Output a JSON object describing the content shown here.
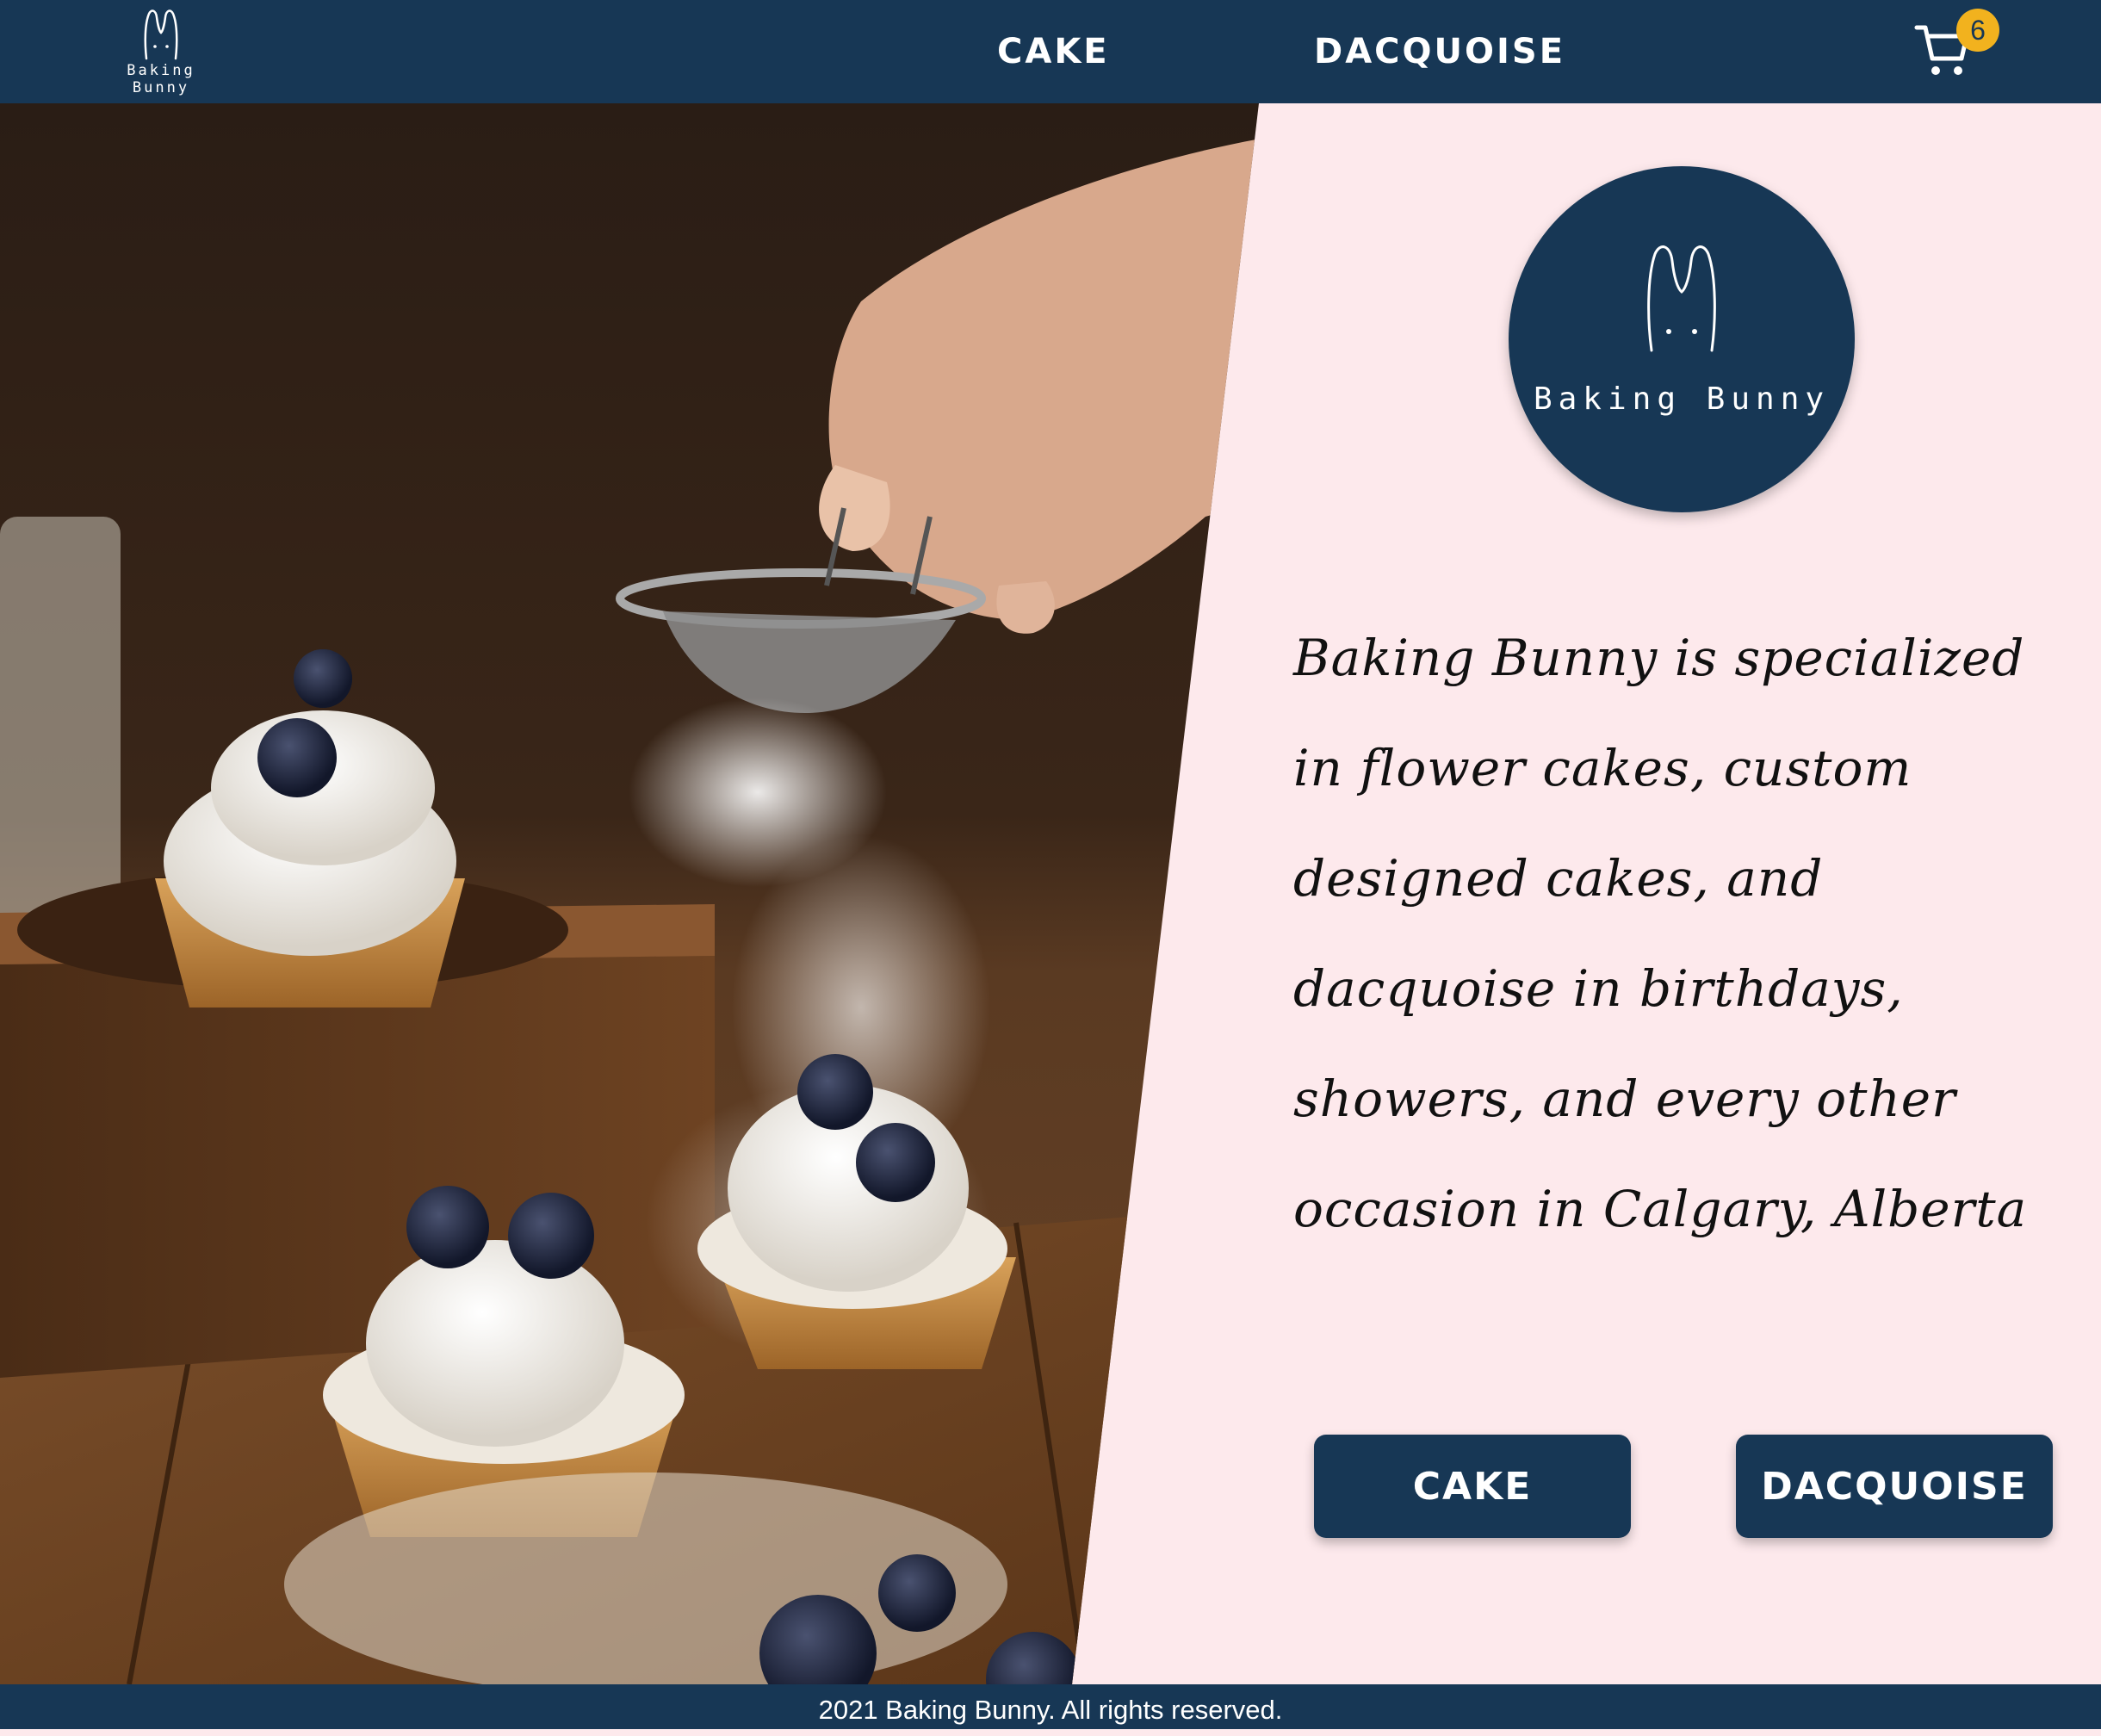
{
  "header": {
    "brand_name": "Baking Bunny",
    "nav": [
      {
        "label": "CAKE"
      },
      {
        "label": "DACQUOISE"
      }
    ],
    "cart": {
      "icon": "cart-icon",
      "count": "6"
    }
  },
  "hero_image": {
    "subject": "hero-photo"
  },
  "logo": {
    "text": "Baking Bunny"
  },
  "description": "Baking Bunny is specialized in flower cakes, custom designed cakes, and dacquoise in birthdays, showers, and every other occasion in Calgary, Alberta",
  "buttons": {
    "cake": "CAKE",
    "dacquoise": "DACQUOISE"
  },
  "footer": {
    "text": "2021 Baking Bunny. All rights reserved."
  },
  "colors": {
    "navy": "#173755",
    "background": "#fde9ec",
    "badge": "#f2b21e"
  }
}
